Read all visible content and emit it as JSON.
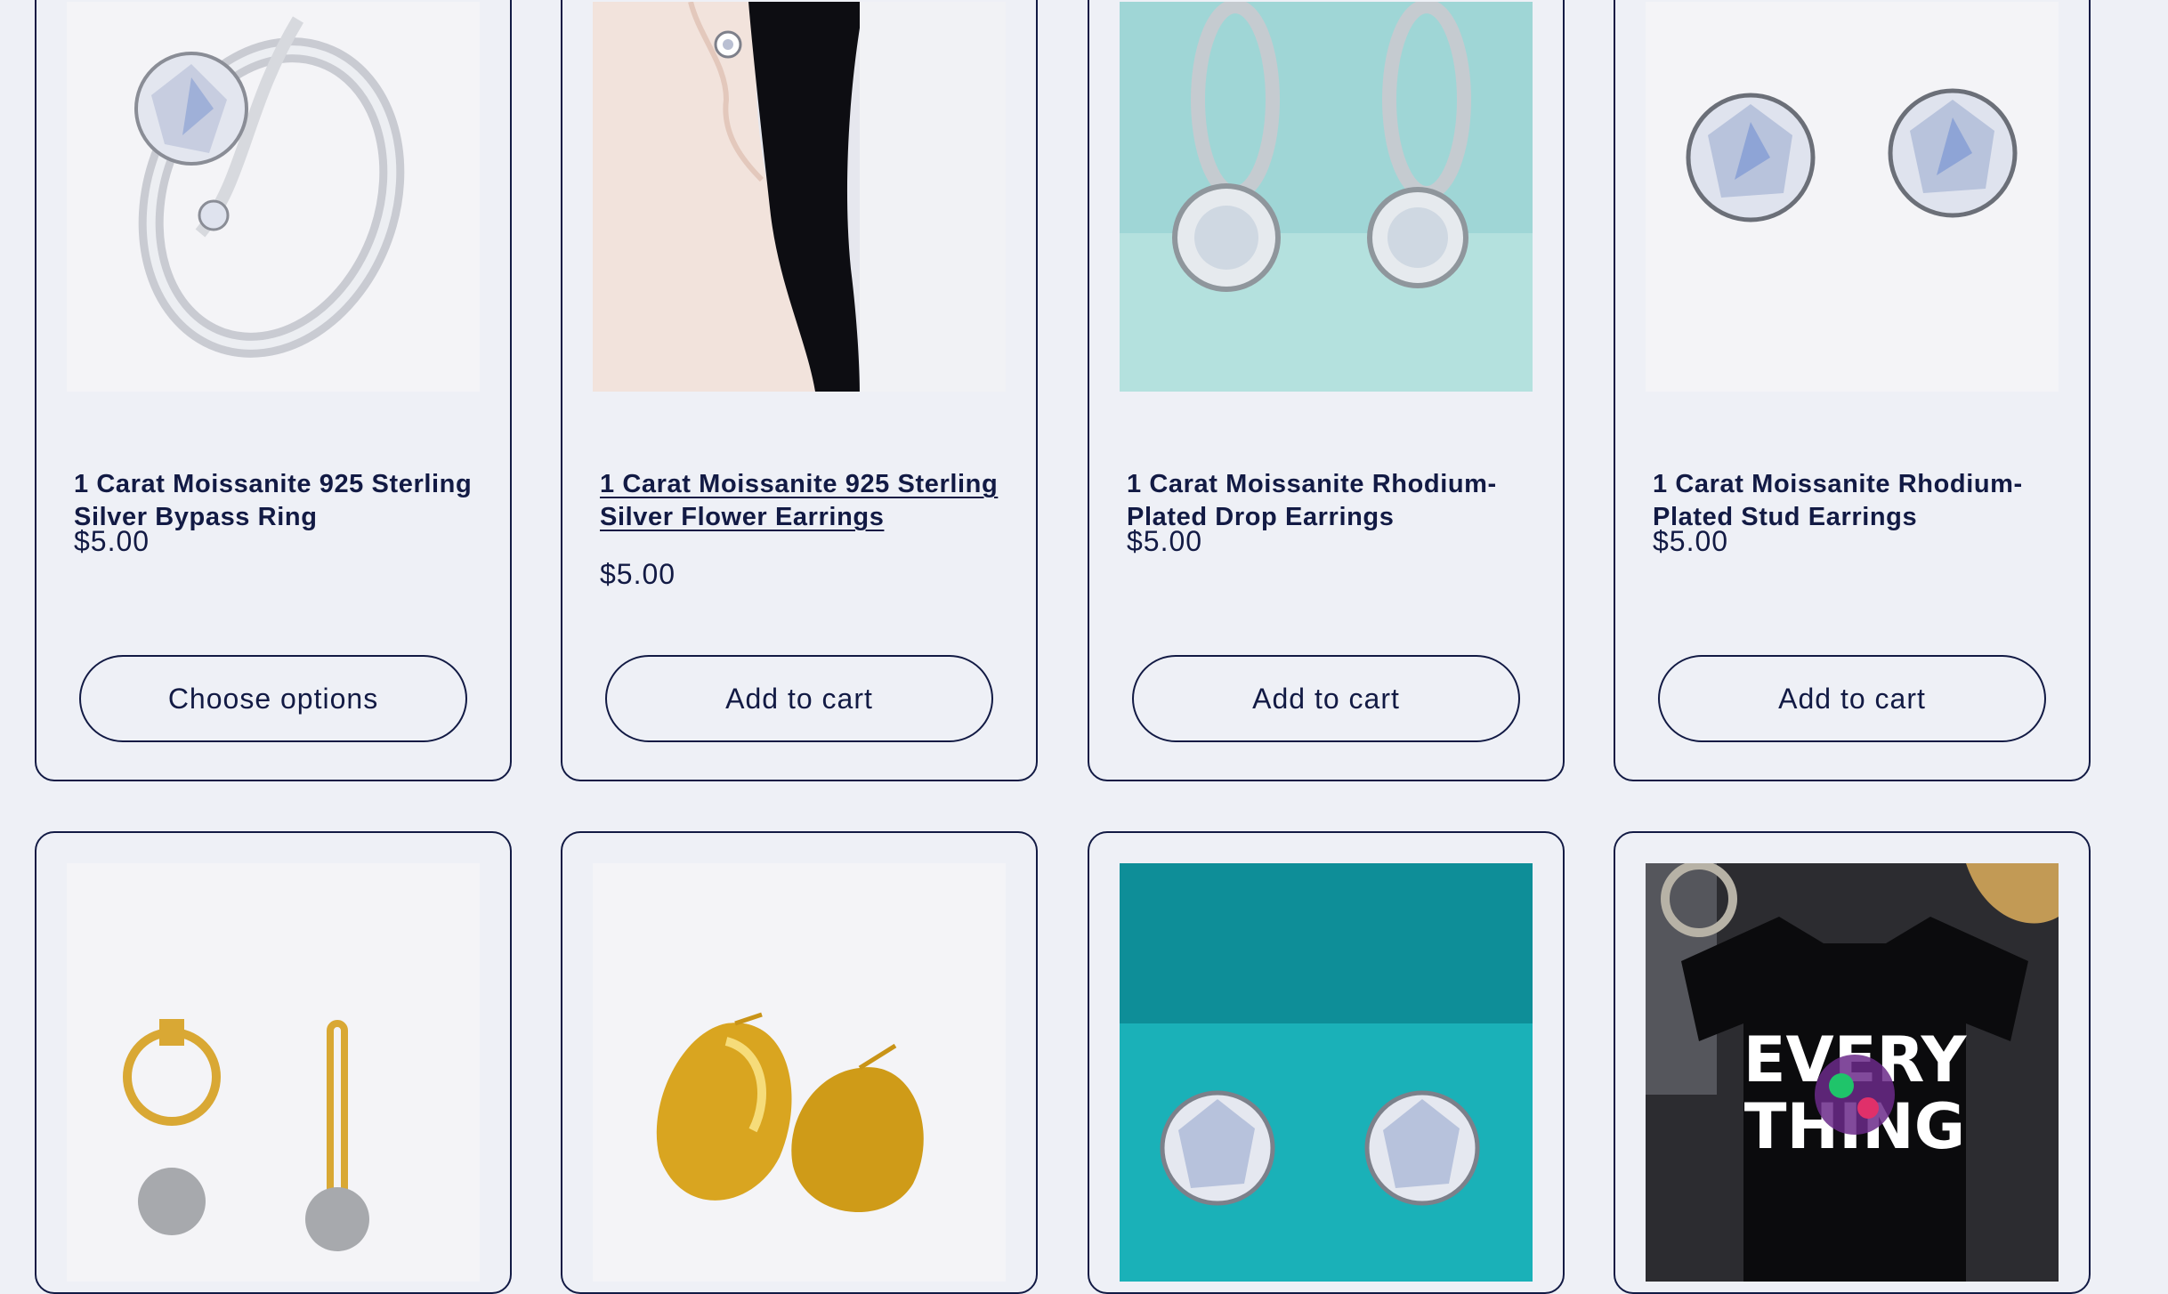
{
  "products": [
    {
      "title": "1 Carat Moissanite 925 Sterling Silver Bypass Ring",
      "price": "$5.00",
      "button": "Choose options",
      "image": "bypass-ring-image"
    },
    {
      "title": "1 Carat Moissanite 925 Sterling Silver Flower Earrings",
      "price": "$5.00",
      "button": "Add to cart",
      "image": "flower-earring-model-image"
    },
    {
      "title": "1 Carat Moissanite Rhodium-Plated Drop Earrings",
      "price": "$5.00",
      "button": "Add to cart",
      "image": "drop-earrings-image"
    },
    {
      "title": "1 Carat Moissanite Rhodium-Plated Stud Earrings",
      "price": "$5.00",
      "button": "Add to cart",
      "image": "stud-earrings-image"
    },
    {
      "image": "gold-hoop-pearl-earrings-image"
    },
    {
      "image": "gold-dome-earrings-image"
    },
    {
      "image": "moissanite-studs-teal-image"
    },
    {
      "image": "every-thing-tshirt-image"
    }
  ],
  "tshirt_print": {
    "line1": "EVERY",
    "line2": "THING"
  },
  "colors": {
    "background": "#eef0f6",
    "text": "#121a44",
    "border": "#121a44"
  }
}
